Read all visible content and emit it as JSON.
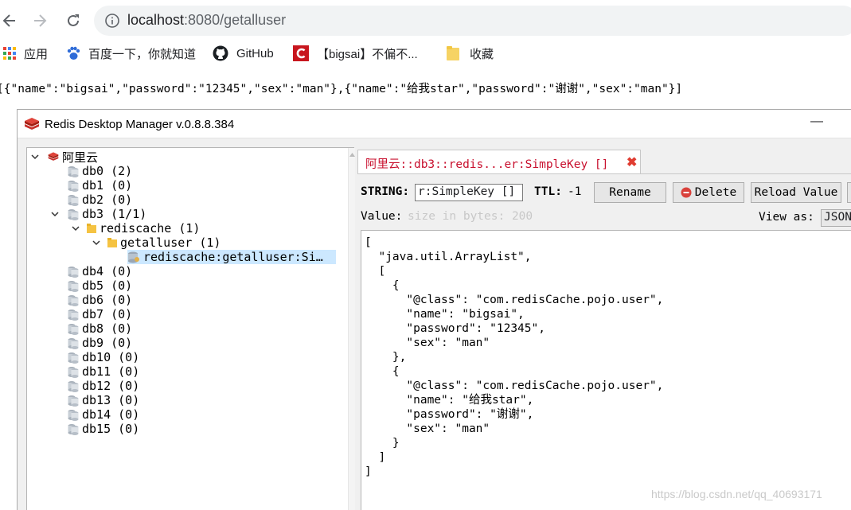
{
  "browser": {
    "url_host": "localhost",
    "url_path": ":8080/getalluser",
    "bookmarks": [
      {
        "label": "应用",
        "icon": "apps-grid-icon"
      },
      {
        "label": "百度一下，你就知道",
        "icon": "baidu-paw-icon"
      },
      {
        "label": "GitHub",
        "icon": "github-icon"
      },
      {
        "label": "【bigsai】不偏不...",
        "icon": "csdn-icon"
      },
      {
        "label": "收藏",
        "icon": "folder-icon"
      }
    ]
  },
  "page": {
    "json_text": "[{\"name\":\"bigsai\",\"password\":\"12345\",\"sex\":\"man\"},{\"name\":\"给我star\",\"password\":\"谢谢\",\"sex\":\"man\"}]"
  },
  "rdm": {
    "title": "Redis Desktop Manager v.0.8.8.384",
    "minimize": "—",
    "tree": {
      "server": "阿里云",
      "dbs_top": [
        "db0 (2)",
        "db1 (0)",
        "db2 (0)",
        "db3  (1/1)"
      ],
      "namespace": "rediscache (1)",
      "subnamespace": "getalluser (1)",
      "key": "rediscache:getalluser:Si…",
      "dbs_bottom": [
        "db4 (0)",
        "db5 (0)",
        "db6 (0)",
        "db7 (0)",
        "db8 (0)",
        "db9 (0)",
        "db10 (0)",
        "db11 (0)",
        "db12 (0)",
        "db13 (0)",
        "db14 (0)",
        "db15 (0)"
      ]
    },
    "tab": {
      "label": "阿里云::db3::redis...er:SimpleKey []",
      "close": "✖"
    },
    "key_type_label": "STRING:",
    "key_name": "r:SimpleKey []",
    "ttl_label": "TTL:",
    "ttl_value": "-1",
    "buttons": {
      "rename": "Rename",
      "delete": "Delete",
      "reload": "Reload Value"
    },
    "value_label": "Value:",
    "value_placeholder": "size in bytes: 200",
    "view_as_label": "View as:",
    "view_as_value": "JSON",
    "value_lines": [
      "[",
      "  \"java.util.ArrayList\",",
      "  [",
      "    {",
      "      \"@class\": \"com.redisCache.pojo.user\",",
      "      \"name\": \"bigsai\",",
      "      \"password\": \"12345\",",
      "      \"sex\": \"man\"",
      "    },",
      "    {",
      "      \"@class\": \"com.redisCache.pojo.user\",",
      "      \"name\": \"给我star\",",
      "      \"password\": \"谢谢\",",
      "      \"sex\": \"man\"",
      "    }",
      "  ]",
      "]"
    ]
  },
  "watermark": "https://blog.csdn.net/qq_40693171"
}
